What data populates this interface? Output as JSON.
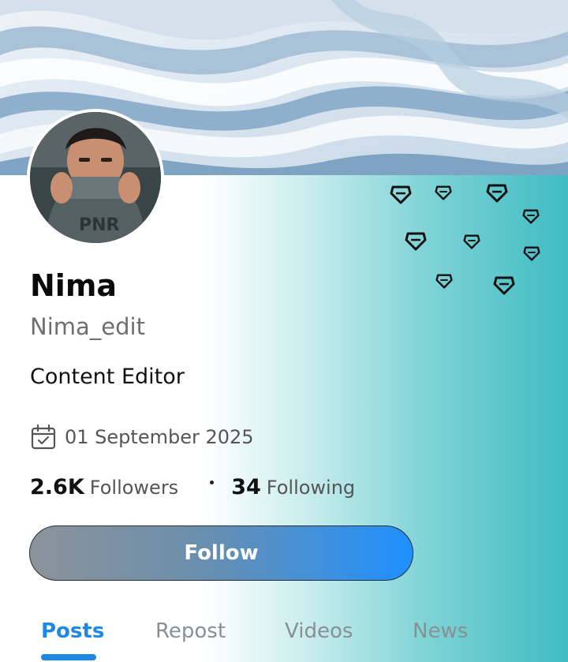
{
  "profile": {
    "display_name": "Nima",
    "username": "Nima_edit",
    "bio": "Content Editor",
    "joined_date": "01 September 2025",
    "followers_count": "2.6K",
    "followers_label": "Followers",
    "following_count": "34",
    "following_label": "Following"
  },
  "actions": {
    "follow_label": "Follow"
  },
  "tabs": [
    {
      "label": "Posts",
      "active": true
    },
    {
      "label": "Repost",
      "active": false
    },
    {
      "label": "Videos",
      "active": false
    },
    {
      "label": "News",
      "active": false
    }
  ],
  "icons": {
    "date": "calendar-check-icon",
    "decor": "diamond-icon"
  },
  "colors": {
    "accent": "#1e88e5",
    "teal": "#3fbcc2",
    "button_end": "#1e90ff"
  }
}
